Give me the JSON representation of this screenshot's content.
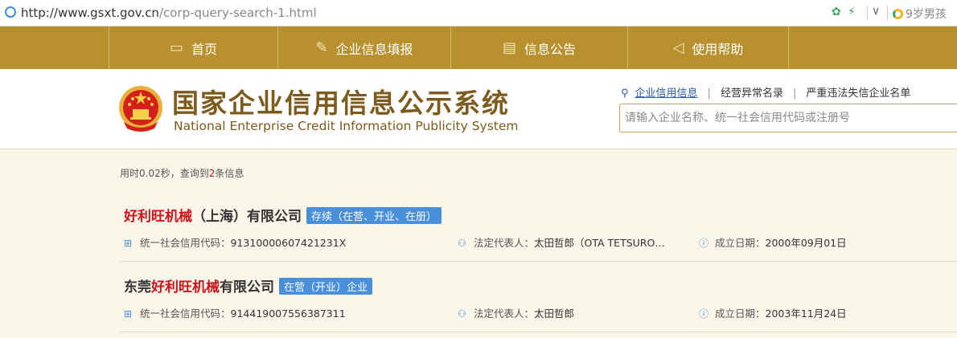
{
  "browser": {
    "url_host": "http://www.gsxt.gov.cn",
    "url_path": "/corp-query-search-1.html",
    "search_hint": "9岁男孩"
  },
  "nav": {
    "items": [
      {
        "label": "首页",
        "icon": "monitor-icon"
      },
      {
        "label": "企业信息填报",
        "icon": "edit-icon"
      },
      {
        "label": "信息公告",
        "icon": "notice-icon"
      },
      {
        "label": "使用帮助",
        "icon": "help-icon"
      }
    ]
  },
  "header": {
    "title_cn": "国家企业信用信息公示系统",
    "title_en": "National Enterprise Credit Information Publicity System",
    "query_tabs": [
      "企业信用信息",
      "经营异常名录",
      "严重违法失信企业名单"
    ],
    "search_placeholder": "请输入企业名称、统一社会信用代码或注册号"
  },
  "results_meta": {
    "prefix": "用时0.02秒，查询到",
    "count": "2",
    "suffix": "条信息"
  },
  "results": [
    {
      "name_hl": "好利旺机械",
      "name_rest": "（上海）有限公司",
      "status": "存续（在营、开业、在册）",
      "credit_label": "统一社会信用代码：",
      "credit_code": "91310000607421231X",
      "rep_label": "法定代表人：",
      "rep": "太田哲郎（OTA TETSURO…",
      "date_label": "成立日期：",
      "date": "2000年09月01日"
    },
    {
      "name_pre": "东莞",
      "name_hl": "好利旺机械",
      "name_rest": "有限公司",
      "status": "在营（开业）企业",
      "credit_label": "统一社会信用代码：",
      "credit_code": "914419007556387311",
      "rep_label": "法定代表人：",
      "rep": "太田哲郎",
      "date_label": "成立日期：",
      "date": "2003年11月24日"
    }
  ],
  "colors": {
    "nav_bg": "#b8902e",
    "title_brown": "#7c5b1d",
    "highlight_red": "#d0111b",
    "badge_blue": "#4a8fd9",
    "page_bg": "#fbf6ea"
  }
}
